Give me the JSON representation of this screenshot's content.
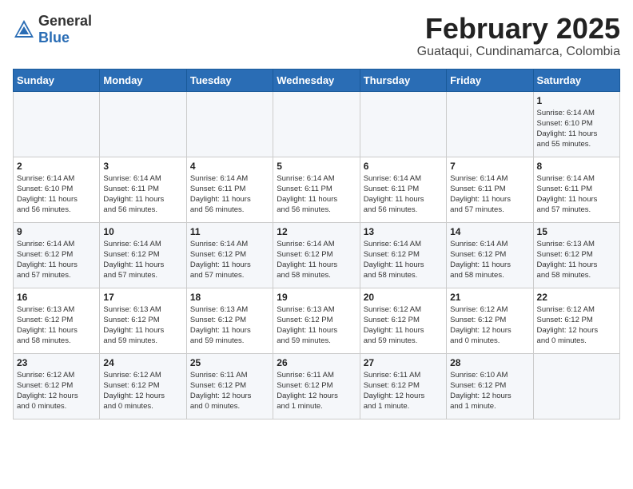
{
  "header": {
    "logo_general": "General",
    "logo_blue": "Blue",
    "month_title": "February 2025",
    "location": "Guataqui, Cundinamarca, Colombia"
  },
  "weekdays": [
    "Sunday",
    "Monday",
    "Tuesday",
    "Wednesday",
    "Thursday",
    "Friday",
    "Saturday"
  ],
  "weeks": [
    [
      {
        "day": "",
        "info": ""
      },
      {
        "day": "",
        "info": ""
      },
      {
        "day": "",
        "info": ""
      },
      {
        "day": "",
        "info": ""
      },
      {
        "day": "",
        "info": ""
      },
      {
        "day": "",
        "info": ""
      },
      {
        "day": "1",
        "info": "Sunrise: 6:14 AM\nSunset: 6:10 PM\nDaylight: 11 hours\nand 55 minutes."
      }
    ],
    [
      {
        "day": "2",
        "info": "Sunrise: 6:14 AM\nSunset: 6:10 PM\nDaylight: 11 hours\nand 56 minutes."
      },
      {
        "day": "3",
        "info": "Sunrise: 6:14 AM\nSunset: 6:11 PM\nDaylight: 11 hours\nand 56 minutes."
      },
      {
        "day": "4",
        "info": "Sunrise: 6:14 AM\nSunset: 6:11 PM\nDaylight: 11 hours\nand 56 minutes."
      },
      {
        "day": "5",
        "info": "Sunrise: 6:14 AM\nSunset: 6:11 PM\nDaylight: 11 hours\nand 56 minutes."
      },
      {
        "day": "6",
        "info": "Sunrise: 6:14 AM\nSunset: 6:11 PM\nDaylight: 11 hours\nand 56 minutes."
      },
      {
        "day": "7",
        "info": "Sunrise: 6:14 AM\nSunset: 6:11 PM\nDaylight: 11 hours\nand 57 minutes."
      },
      {
        "day": "8",
        "info": "Sunrise: 6:14 AM\nSunset: 6:11 PM\nDaylight: 11 hours\nand 57 minutes."
      }
    ],
    [
      {
        "day": "9",
        "info": "Sunrise: 6:14 AM\nSunset: 6:12 PM\nDaylight: 11 hours\nand 57 minutes."
      },
      {
        "day": "10",
        "info": "Sunrise: 6:14 AM\nSunset: 6:12 PM\nDaylight: 11 hours\nand 57 minutes."
      },
      {
        "day": "11",
        "info": "Sunrise: 6:14 AM\nSunset: 6:12 PM\nDaylight: 11 hours\nand 57 minutes."
      },
      {
        "day": "12",
        "info": "Sunrise: 6:14 AM\nSunset: 6:12 PM\nDaylight: 11 hours\nand 58 minutes."
      },
      {
        "day": "13",
        "info": "Sunrise: 6:14 AM\nSunset: 6:12 PM\nDaylight: 11 hours\nand 58 minutes."
      },
      {
        "day": "14",
        "info": "Sunrise: 6:14 AM\nSunset: 6:12 PM\nDaylight: 11 hours\nand 58 minutes."
      },
      {
        "day": "15",
        "info": "Sunrise: 6:13 AM\nSunset: 6:12 PM\nDaylight: 11 hours\nand 58 minutes."
      }
    ],
    [
      {
        "day": "16",
        "info": "Sunrise: 6:13 AM\nSunset: 6:12 PM\nDaylight: 11 hours\nand 58 minutes."
      },
      {
        "day": "17",
        "info": "Sunrise: 6:13 AM\nSunset: 6:12 PM\nDaylight: 11 hours\nand 59 minutes."
      },
      {
        "day": "18",
        "info": "Sunrise: 6:13 AM\nSunset: 6:12 PM\nDaylight: 11 hours\nand 59 minutes."
      },
      {
        "day": "19",
        "info": "Sunrise: 6:13 AM\nSunset: 6:12 PM\nDaylight: 11 hours\nand 59 minutes."
      },
      {
        "day": "20",
        "info": "Sunrise: 6:12 AM\nSunset: 6:12 PM\nDaylight: 11 hours\nand 59 minutes."
      },
      {
        "day": "21",
        "info": "Sunrise: 6:12 AM\nSunset: 6:12 PM\nDaylight: 12 hours\nand 0 minutes."
      },
      {
        "day": "22",
        "info": "Sunrise: 6:12 AM\nSunset: 6:12 PM\nDaylight: 12 hours\nand 0 minutes."
      }
    ],
    [
      {
        "day": "23",
        "info": "Sunrise: 6:12 AM\nSunset: 6:12 PM\nDaylight: 12 hours\nand 0 minutes."
      },
      {
        "day": "24",
        "info": "Sunrise: 6:12 AM\nSunset: 6:12 PM\nDaylight: 12 hours\nand 0 minutes."
      },
      {
        "day": "25",
        "info": "Sunrise: 6:11 AM\nSunset: 6:12 PM\nDaylight: 12 hours\nand 0 minutes."
      },
      {
        "day": "26",
        "info": "Sunrise: 6:11 AM\nSunset: 6:12 PM\nDaylight: 12 hours\nand 1 minute."
      },
      {
        "day": "27",
        "info": "Sunrise: 6:11 AM\nSunset: 6:12 PM\nDaylight: 12 hours\nand 1 minute."
      },
      {
        "day": "28",
        "info": "Sunrise: 6:10 AM\nSunset: 6:12 PM\nDaylight: 12 hours\nand 1 minute."
      },
      {
        "day": "",
        "info": ""
      }
    ]
  ]
}
